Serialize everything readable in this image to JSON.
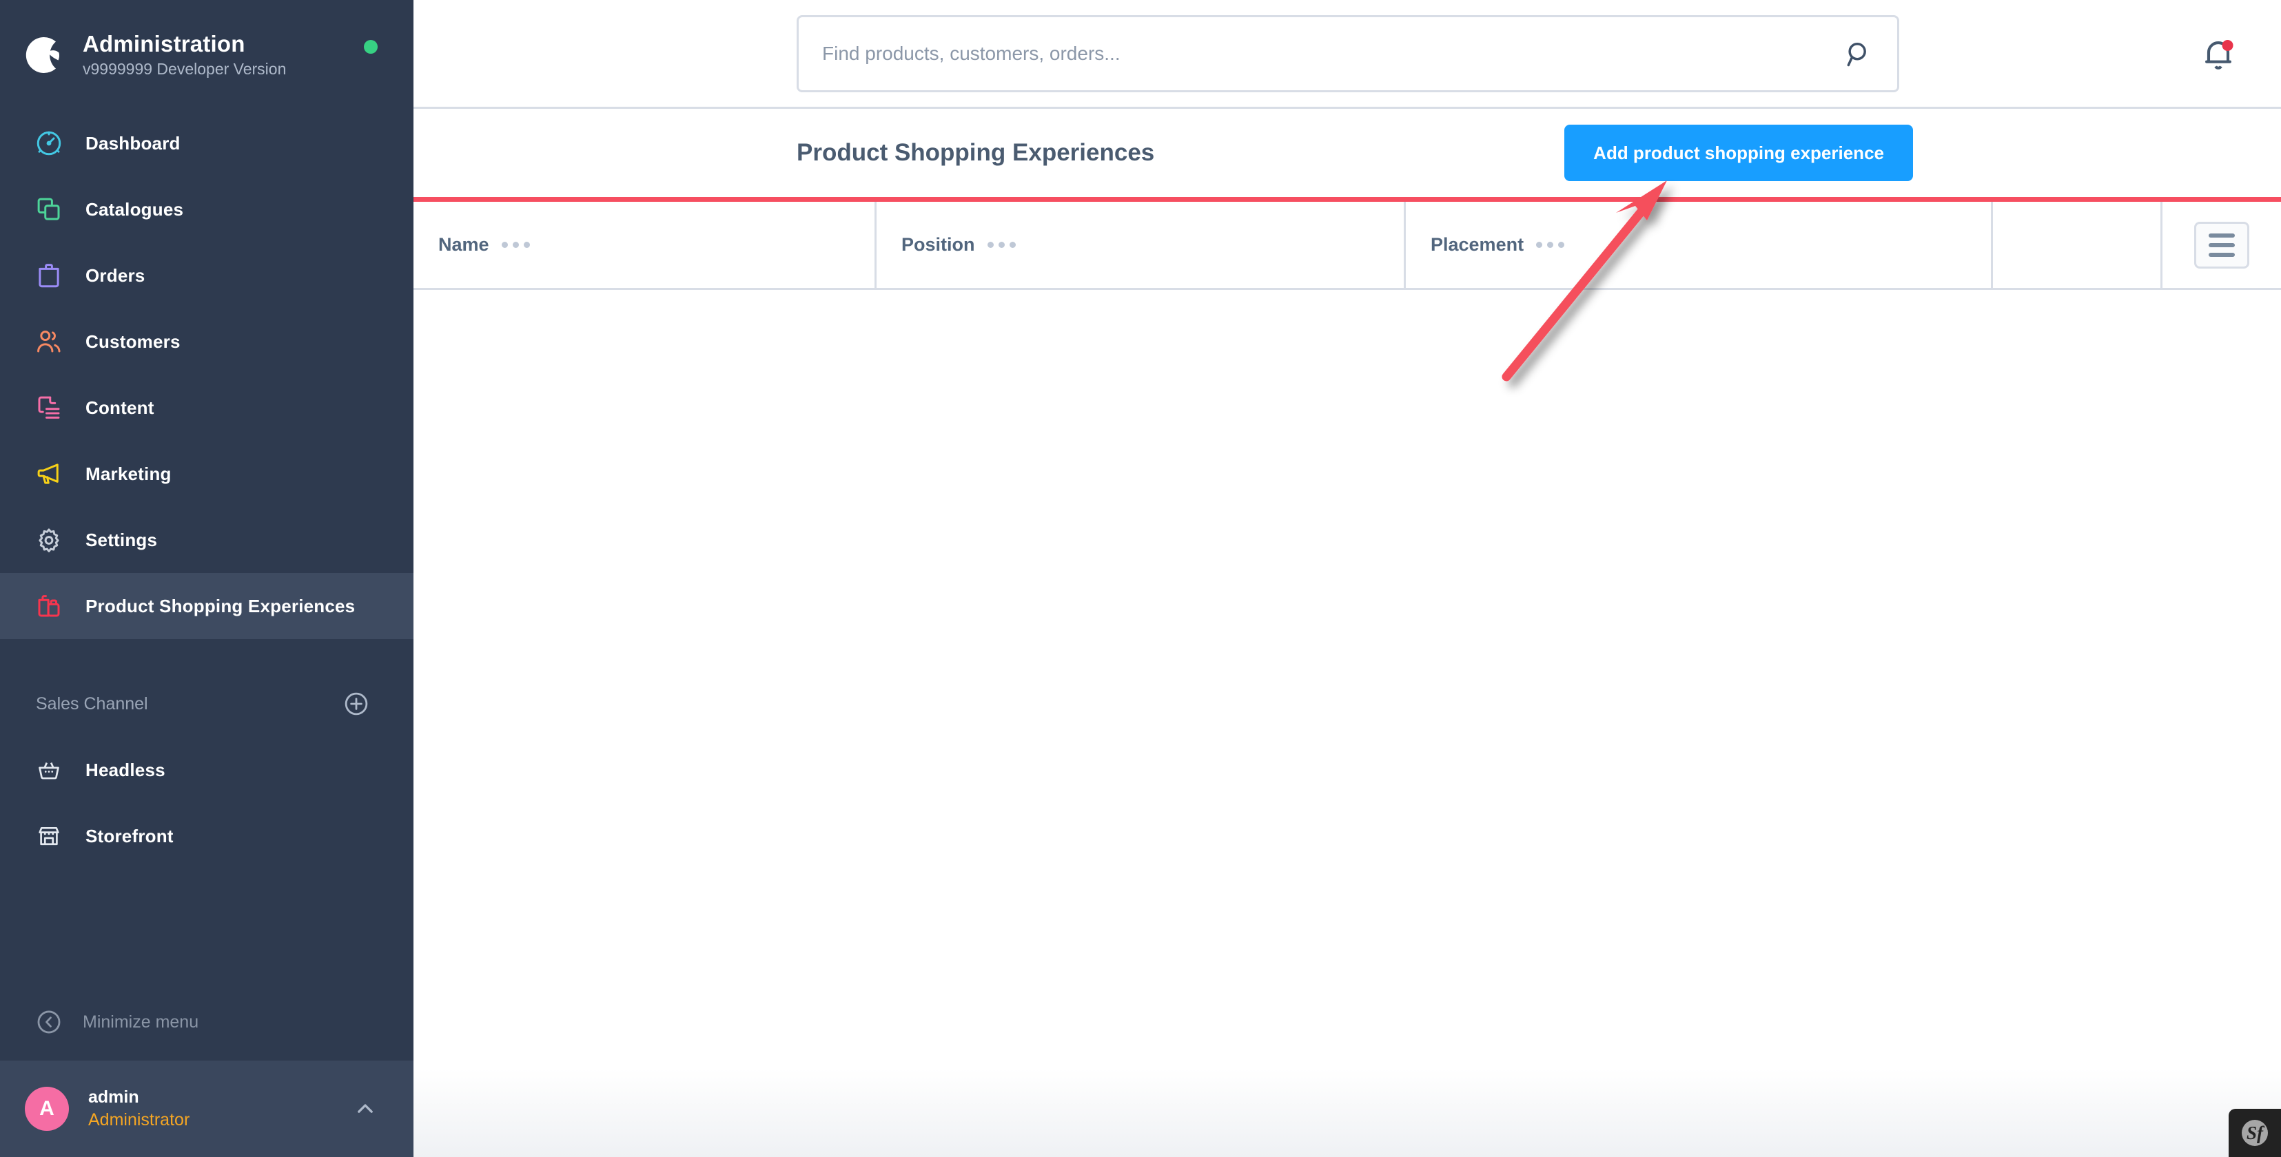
{
  "brand": {
    "title": "Administration",
    "version": "v9999999 Developer Version",
    "logo_icon": "shopware-logo-icon",
    "status_dot": "online-status-dot",
    "status_color": "#37D183"
  },
  "sidebar": {
    "items": [
      {
        "label": "Dashboard",
        "icon": "dashboard-gauge-icon",
        "color": "#43C8E4",
        "active": false
      },
      {
        "label": "Catalogues",
        "icon": "catalogues-copy-icon",
        "color": "#4DD599",
        "active": false
      },
      {
        "label": "Orders",
        "icon": "orders-bag-icon",
        "color": "#9B8CF7",
        "active": false
      },
      {
        "label": "Customers",
        "icon": "customers-people-icon",
        "color": "#F88962",
        "active": false
      },
      {
        "label": "Content",
        "icon": "content-document-icon",
        "color": "#F66EA8",
        "active": false
      },
      {
        "label": "Marketing",
        "icon": "marketing-megaphone-icon",
        "color": "#F7D117",
        "active": false
      },
      {
        "label": "Settings",
        "icon": "settings-gear-icon",
        "color": "#C6CDD8",
        "active": false
      },
      {
        "label": "Product Shopping Experiences",
        "icon": "product-shopping-experiences-icon",
        "color": "#F7354E",
        "active": true
      }
    ],
    "sales_channel": {
      "title": "Sales Channel",
      "add_icon": "plus-circle-icon",
      "channels": [
        {
          "label": "Headless",
          "icon": "headless-basket-icon"
        },
        {
          "label": "Storefront",
          "icon": "storefront-shop-icon"
        }
      ]
    },
    "minimize": {
      "label": "Minimize menu",
      "icon": "chevron-left-circle-icon"
    },
    "user": {
      "avatar_initial": "A",
      "avatar_color": "#F56DA4",
      "name": "admin",
      "role": "Administrator",
      "role_color": "#F5A623",
      "caret_icon": "chevron-up-icon"
    }
  },
  "topbar": {
    "search": {
      "placeholder": "Find products, customers, orders...",
      "value": "",
      "icon": "search-icon"
    },
    "notifications": {
      "icon": "bell-icon",
      "has_unread": true,
      "badge_color": "#E8334A"
    }
  },
  "page": {
    "title": "Product Shopping Experiences",
    "add_button": {
      "label": "Add product shopping experience",
      "color": "#189EFF"
    },
    "accent_line_color": "#F64E60"
  },
  "table": {
    "columns": [
      {
        "label": "Name",
        "menu_icon": "column-context-menu-icon"
      },
      {
        "label": "Position",
        "menu_icon": "column-context-menu-icon"
      },
      {
        "label": "Placement",
        "menu_icon": "column-context-menu-icon"
      }
    ],
    "rows": [],
    "list_settings_icon": "list-settings-icon"
  },
  "annotation": {
    "type": "arrow",
    "color": "#F5505C",
    "points_to": "add-product-shopping-experience-button"
  },
  "profiler": {
    "label": "Sf",
    "name": "symfony-profiler-badge"
  }
}
